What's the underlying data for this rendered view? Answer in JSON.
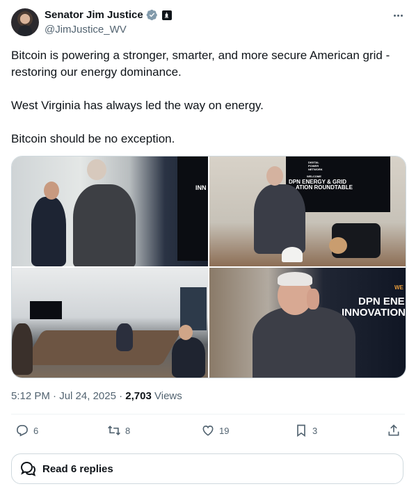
{
  "author": {
    "display_name": "Senator Jim Justice",
    "handle": "@JimJustice_WV",
    "verified": true
  },
  "tweet": {
    "paragraphs": [
      "Bitcoin is powering a stronger, smarter, and more secure American grid - restoring our energy dominance.",
      "West Virginia has always led the way on energy.",
      "Bitcoin should be no exception."
    ]
  },
  "media": {
    "photo2_screen": {
      "line1": "DIGITAL",
      "line2": "POWER",
      "line3": "NETWORK",
      "line4": "WELCOME",
      "line5": "DPN ENERGY & GRID",
      "line6": "ATION ROUNDTABLE"
    },
    "photo1_screen": "INN",
    "photo4_screen": {
      "line1": "WE",
      "line2": "DPN ENE",
      "line3": "INNOVATION"
    }
  },
  "meta": {
    "time": "5:12 PM",
    "sep1": "·",
    "date": "Jul 24, 2025",
    "sep2": "·",
    "views_count": "2,703",
    "views_label": "Views"
  },
  "actions": {
    "replies": "6",
    "reposts": "8",
    "likes": "19",
    "bookmarks": "3"
  },
  "read_replies_label": "Read 6 replies",
  "colors": {
    "text": "#0f1419",
    "secondary": "#536471",
    "verified": "#829aab",
    "border": "#cfd9de"
  },
  "icons": [
    "more-icon",
    "verified-icon",
    "government-badge-icon",
    "reply-icon",
    "repost-icon",
    "like-icon",
    "bookmark-icon",
    "share-icon",
    "speech-bubbles-icon"
  ]
}
